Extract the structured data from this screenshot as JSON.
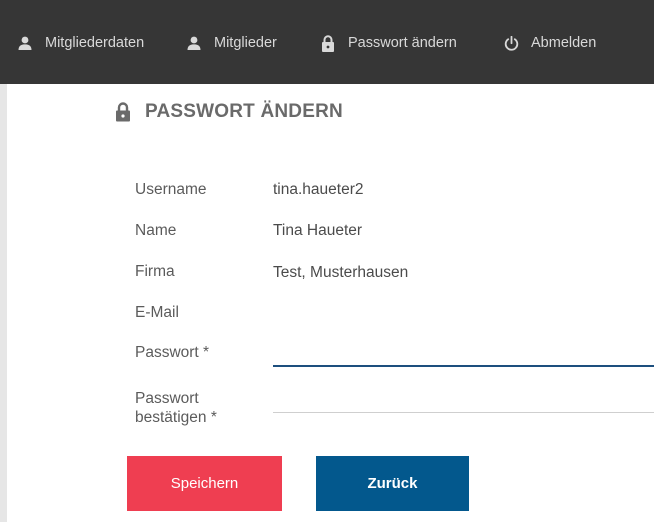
{
  "nav": {
    "items": [
      {
        "label": "Mitgliederdaten",
        "icon": "person-icon"
      },
      {
        "label": "Mitglieder",
        "icon": "person-icon"
      },
      {
        "label": "Passwort ändern",
        "icon": "lock-icon"
      },
      {
        "label": "Abmelden",
        "icon": "power-icon"
      }
    ]
  },
  "page": {
    "title": "PASSWORT ÄNDERN",
    "title_icon": "lock-icon"
  },
  "form": {
    "username_label": "Username",
    "username_value": "tina.haueter2",
    "name_label": "Name",
    "name_value": "Tina Haueter",
    "firma_label": "Firma",
    "firma_value": "Test, Musterhausen",
    "email_label": "E-Mail",
    "email_value": "",
    "password_label": "Passwort *",
    "password_value": "",
    "password_confirm_label_line1": "Passwort",
    "password_confirm_label_line2": "bestätigen *",
    "password_confirm_value": ""
  },
  "buttons": {
    "save_label": "Speichern",
    "back_label": "Zurück"
  },
  "colors": {
    "topbar": "#363636",
    "save": "#ef3e51",
    "back": "#03588d",
    "input_focus": "#1d4f7e"
  }
}
